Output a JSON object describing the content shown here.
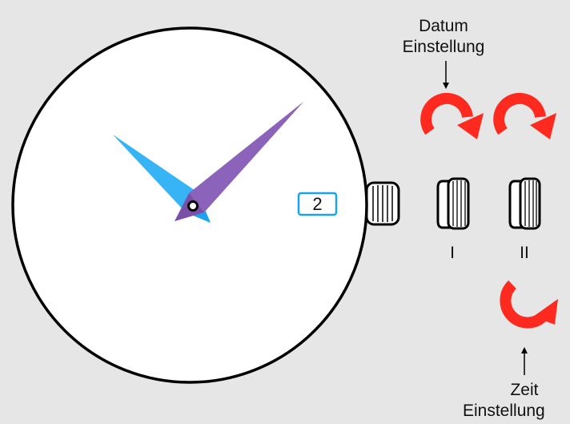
{
  "labels": {
    "datum_line1": "Datum",
    "datum_line2": "Einstellung",
    "position_1": "I",
    "position_2": "II",
    "zeit_line1": "Zeit",
    "zeit_line2": "Einstellung"
  },
  "date_window": {
    "value": "2",
    "border_color": "#1aa3e8"
  },
  "colors": {
    "background": "#e6e6e6",
    "dial": "#ffffff",
    "hour_hand": "#1ba3f2",
    "minute_hand": "#7a4fa8",
    "rotation_arrows": "#ff2a1f",
    "outline": "#000000"
  },
  "icons": {
    "datum_arrows": [
      "rotate-clockwise-icon",
      "rotate-clockwise-icon"
    ],
    "zeit_arrow": "rotate-counterclockwise-icon",
    "pointer_arrows": [
      "arrow-down-icon",
      "arrow-up-icon"
    ],
    "crowns": [
      "crown-pushed-in",
      "crown-position-1",
      "crown-position-2"
    ]
  }
}
